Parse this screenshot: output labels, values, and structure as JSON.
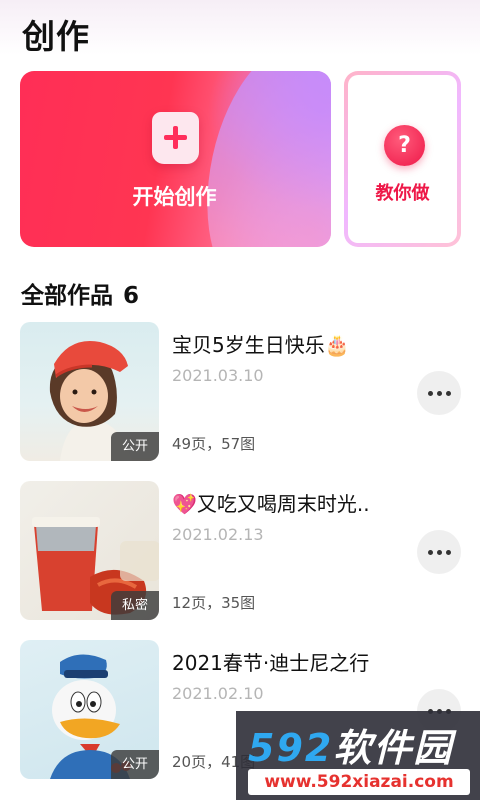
{
  "header": {
    "title": "创作"
  },
  "create_card": {
    "label": "开始创作"
  },
  "tutorial_card": {
    "label": "教你做",
    "icon_symbol": "?"
  },
  "section": {
    "title": "全部作品",
    "count": "6"
  },
  "works": [
    {
      "title": "宝贝5岁生日快乐🎂",
      "date": "2021.03.10",
      "stats": "49页，57图",
      "visibility": "公开"
    },
    {
      "title": "💖又吃又喝周末时光..",
      "date": "2021.02.13",
      "stats": "12页，35图",
      "visibility": "私密"
    },
    {
      "title": "2021春节·迪士尼之行",
      "date": "2021.02.10",
      "stats": "20页，41图",
      "visibility": "公开"
    }
  ],
  "watermark": {
    "logo_num": "592",
    "logo_text": "软件园",
    "url": "www.592xiazai.com"
  },
  "colors": {
    "accent": "#ee1848",
    "card_gradient_start": "#ff2e56",
    "card_gradient_end": "#e7a2ff"
  }
}
